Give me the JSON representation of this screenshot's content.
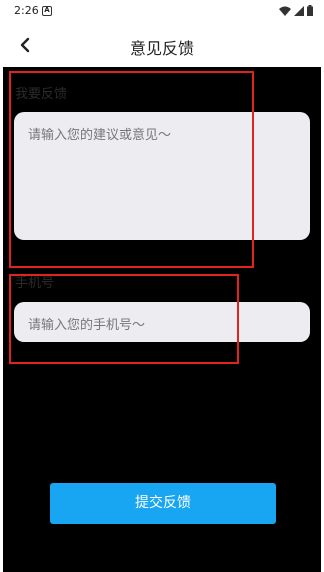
{
  "status_bar": {
    "time": "2:26",
    "notification_glyph": "A",
    "icons": [
      "wifi-icon",
      "signal-icon",
      "battery-icon"
    ]
  },
  "header": {
    "title": "意见反馈",
    "back_icon": "chevron-left-icon"
  },
  "feedback": {
    "label": "我要反馈",
    "placeholder": "请输入您的建议或意见～"
  },
  "phone": {
    "label": "手机号",
    "placeholder": "请输入您的手机号～"
  },
  "submit": {
    "label": "提交反馈"
  },
  "colors": {
    "background": "#000000",
    "field": "#ececf1",
    "accent": "#18a6f2",
    "highlight": "#e0231e"
  }
}
